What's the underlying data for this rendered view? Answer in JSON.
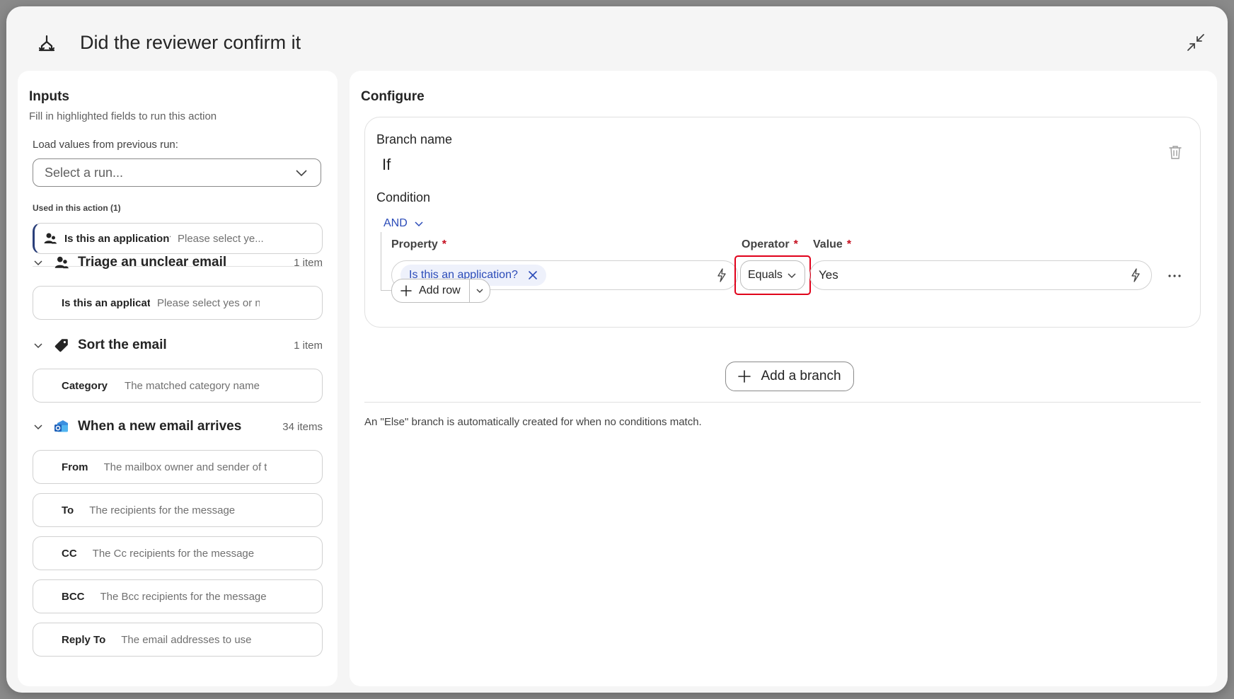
{
  "header": {
    "title": "Did the reviewer confirm it",
    "icon": "branch-merge-icon"
  },
  "inputs": {
    "title": "Inputs",
    "subtitle": "Fill in highlighted fields to run this action",
    "load_label": "Load values from previous run:",
    "select_run_placeholder": "Select a run...",
    "used_label": "Used in this action (1)",
    "used_field": {
      "label": "Is this an application?",
      "placeholder": "Please select ye..."
    },
    "sections": [
      {
        "title": "Triage an unclear email",
        "count": "1 item",
        "icon": "person-group-icon",
        "fields": [
          {
            "label": "Is this an application?",
            "placeholder": "Please select yes or no"
          }
        ]
      },
      {
        "title": "Sort the email",
        "count": "1 item",
        "icon": "tag-icon",
        "fields": [
          {
            "label": "Category",
            "placeholder": "The matched category name"
          }
        ]
      },
      {
        "title": "When a new email arrives",
        "count": "34 items",
        "icon": "outlook-icon",
        "fields": [
          {
            "label": "From",
            "placeholder": "The mailbox owner and sender of the message"
          },
          {
            "label": "To",
            "placeholder": "The recipients for the message"
          },
          {
            "label": "CC",
            "placeholder": "The Cc recipients for the message"
          },
          {
            "label": "BCC",
            "placeholder": "The Bcc recipients for the message"
          },
          {
            "label": "Reply To",
            "placeholder": "The email addresses to use"
          }
        ]
      }
    ]
  },
  "configure": {
    "title": "Configure",
    "branch_name_label": "Branch name",
    "branch_name_value": "If",
    "condition_label": "Condition",
    "logic_operator": "AND",
    "columns": {
      "property": "Property",
      "operator": "Operator",
      "value": "Value"
    },
    "row": {
      "property_chip": "Is this an application?",
      "operator": "Equals",
      "value": "Yes"
    },
    "add_row_label": "Add row",
    "add_branch_label": "Add a branch",
    "else_note": "An \"Else\" branch is automatically created for when no conditions match."
  },
  "colors": {
    "accent": "#2b4bb8",
    "highlight": "#e0001a",
    "required": "#c50f1f"
  }
}
